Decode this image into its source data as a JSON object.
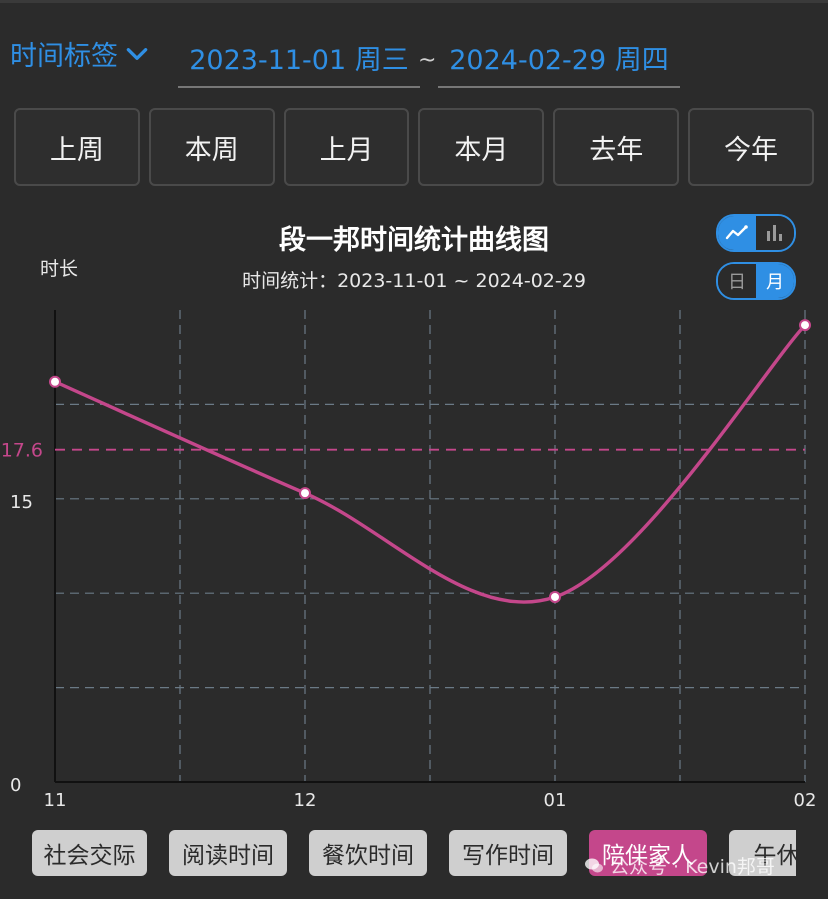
{
  "header": {
    "tag_label": "时间标签",
    "start_date": "2023-11-01 周三",
    "separator": "~",
    "end_date": "2024-02-29 周四"
  },
  "quick_ranges": [
    "上周",
    "本周",
    "上月",
    "本月",
    "去年",
    "今年"
  ],
  "chart_toggles": {
    "type_options": [
      "line-chart-icon",
      "bar-chart-icon"
    ],
    "type_selected": "line",
    "unit_options": [
      "日",
      "月"
    ],
    "unit_selected": "月"
  },
  "colors": {
    "accent": "#2f8fe4",
    "series": "#c4478b",
    "grid": "#6b7a86"
  },
  "chart_data": {
    "type": "line",
    "title": "段一邦时间统计曲线图",
    "subtitle": "时间统计：2023-11-01 ~ 2024-02-29",
    "ylabel": "时长",
    "x": [
      "11",
      "12",
      "01",
      "02"
    ],
    "series": [
      {
        "values": [
          21.2,
          15.3,
          9.8,
          24.2
        ]
      }
    ],
    "average": {
      "label": "17.6",
      "value": 17.6
    },
    "y_ticks": [
      0,
      15
    ],
    "ylim": [
      0,
      25
    ],
    "grid": true
  },
  "categories": [
    {
      "label": "社会交际",
      "active": false
    },
    {
      "label": "阅读时间",
      "active": false
    },
    {
      "label": "餐饮时间",
      "active": false
    },
    {
      "label": "写作时间",
      "active": false
    },
    {
      "label": "陪伴家人",
      "active": true
    },
    {
      "label": "午休时",
      "active": false
    }
  ],
  "watermark": "公众号 · Kevin邦哥"
}
